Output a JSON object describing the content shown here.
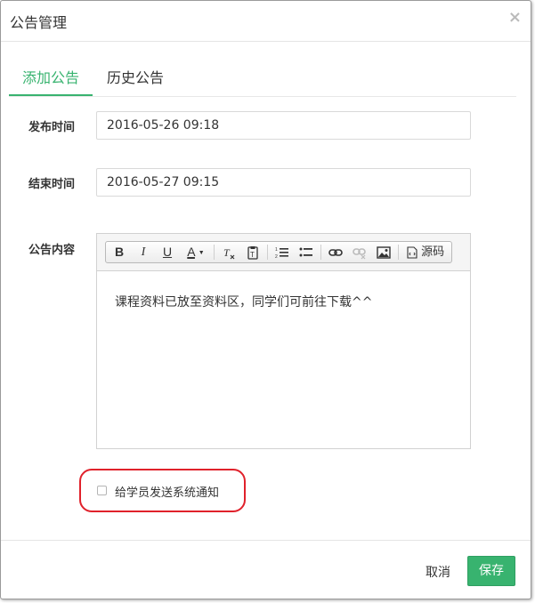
{
  "dialog": {
    "title": "公告管理",
    "close_glyph": "×"
  },
  "tabs": [
    {
      "label": "添加公告",
      "active": true
    },
    {
      "label": "历史公告",
      "active": false
    }
  ],
  "form": {
    "publish_time": {
      "label": "发布时间",
      "value": "2016-05-26 09:18"
    },
    "end_time": {
      "label": "结束时间",
      "value": "2016-05-27 09:15"
    },
    "content": {
      "label": "公告内容",
      "text": "课程资料已放至资料区，同学们可前往下载^^",
      "toolbar": {
        "bold": "B",
        "italic": "I",
        "underline": "U",
        "font_color": "A",
        "source_label": "源码"
      }
    },
    "notify": {
      "label": "给学员发送系统通知",
      "checked": false
    }
  },
  "footer": {
    "cancel_label": "取消",
    "save_label": "保存"
  },
  "colors": {
    "accent": "#38b36f",
    "highlight": "#e0212b"
  }
}
